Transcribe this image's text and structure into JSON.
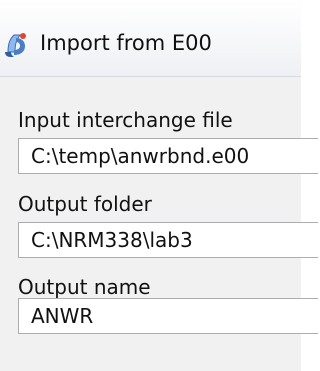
{
  "window": {
    "title": "Import from E00",
    "icon": "arcgis-tool-icon"
  },
  "form": {
    "input_file": {
      "label": "Input interchange file",
      "value": "C:\\temp\\anwrbnd.e00"
    },
    "output_folder": {
      "label": "Output folder",
      "value": "C:\\NRM338\\lab3"
    },
    "output_name": {
      "label": "Output name",
      "value": "ANWR"
    }
  }
}
